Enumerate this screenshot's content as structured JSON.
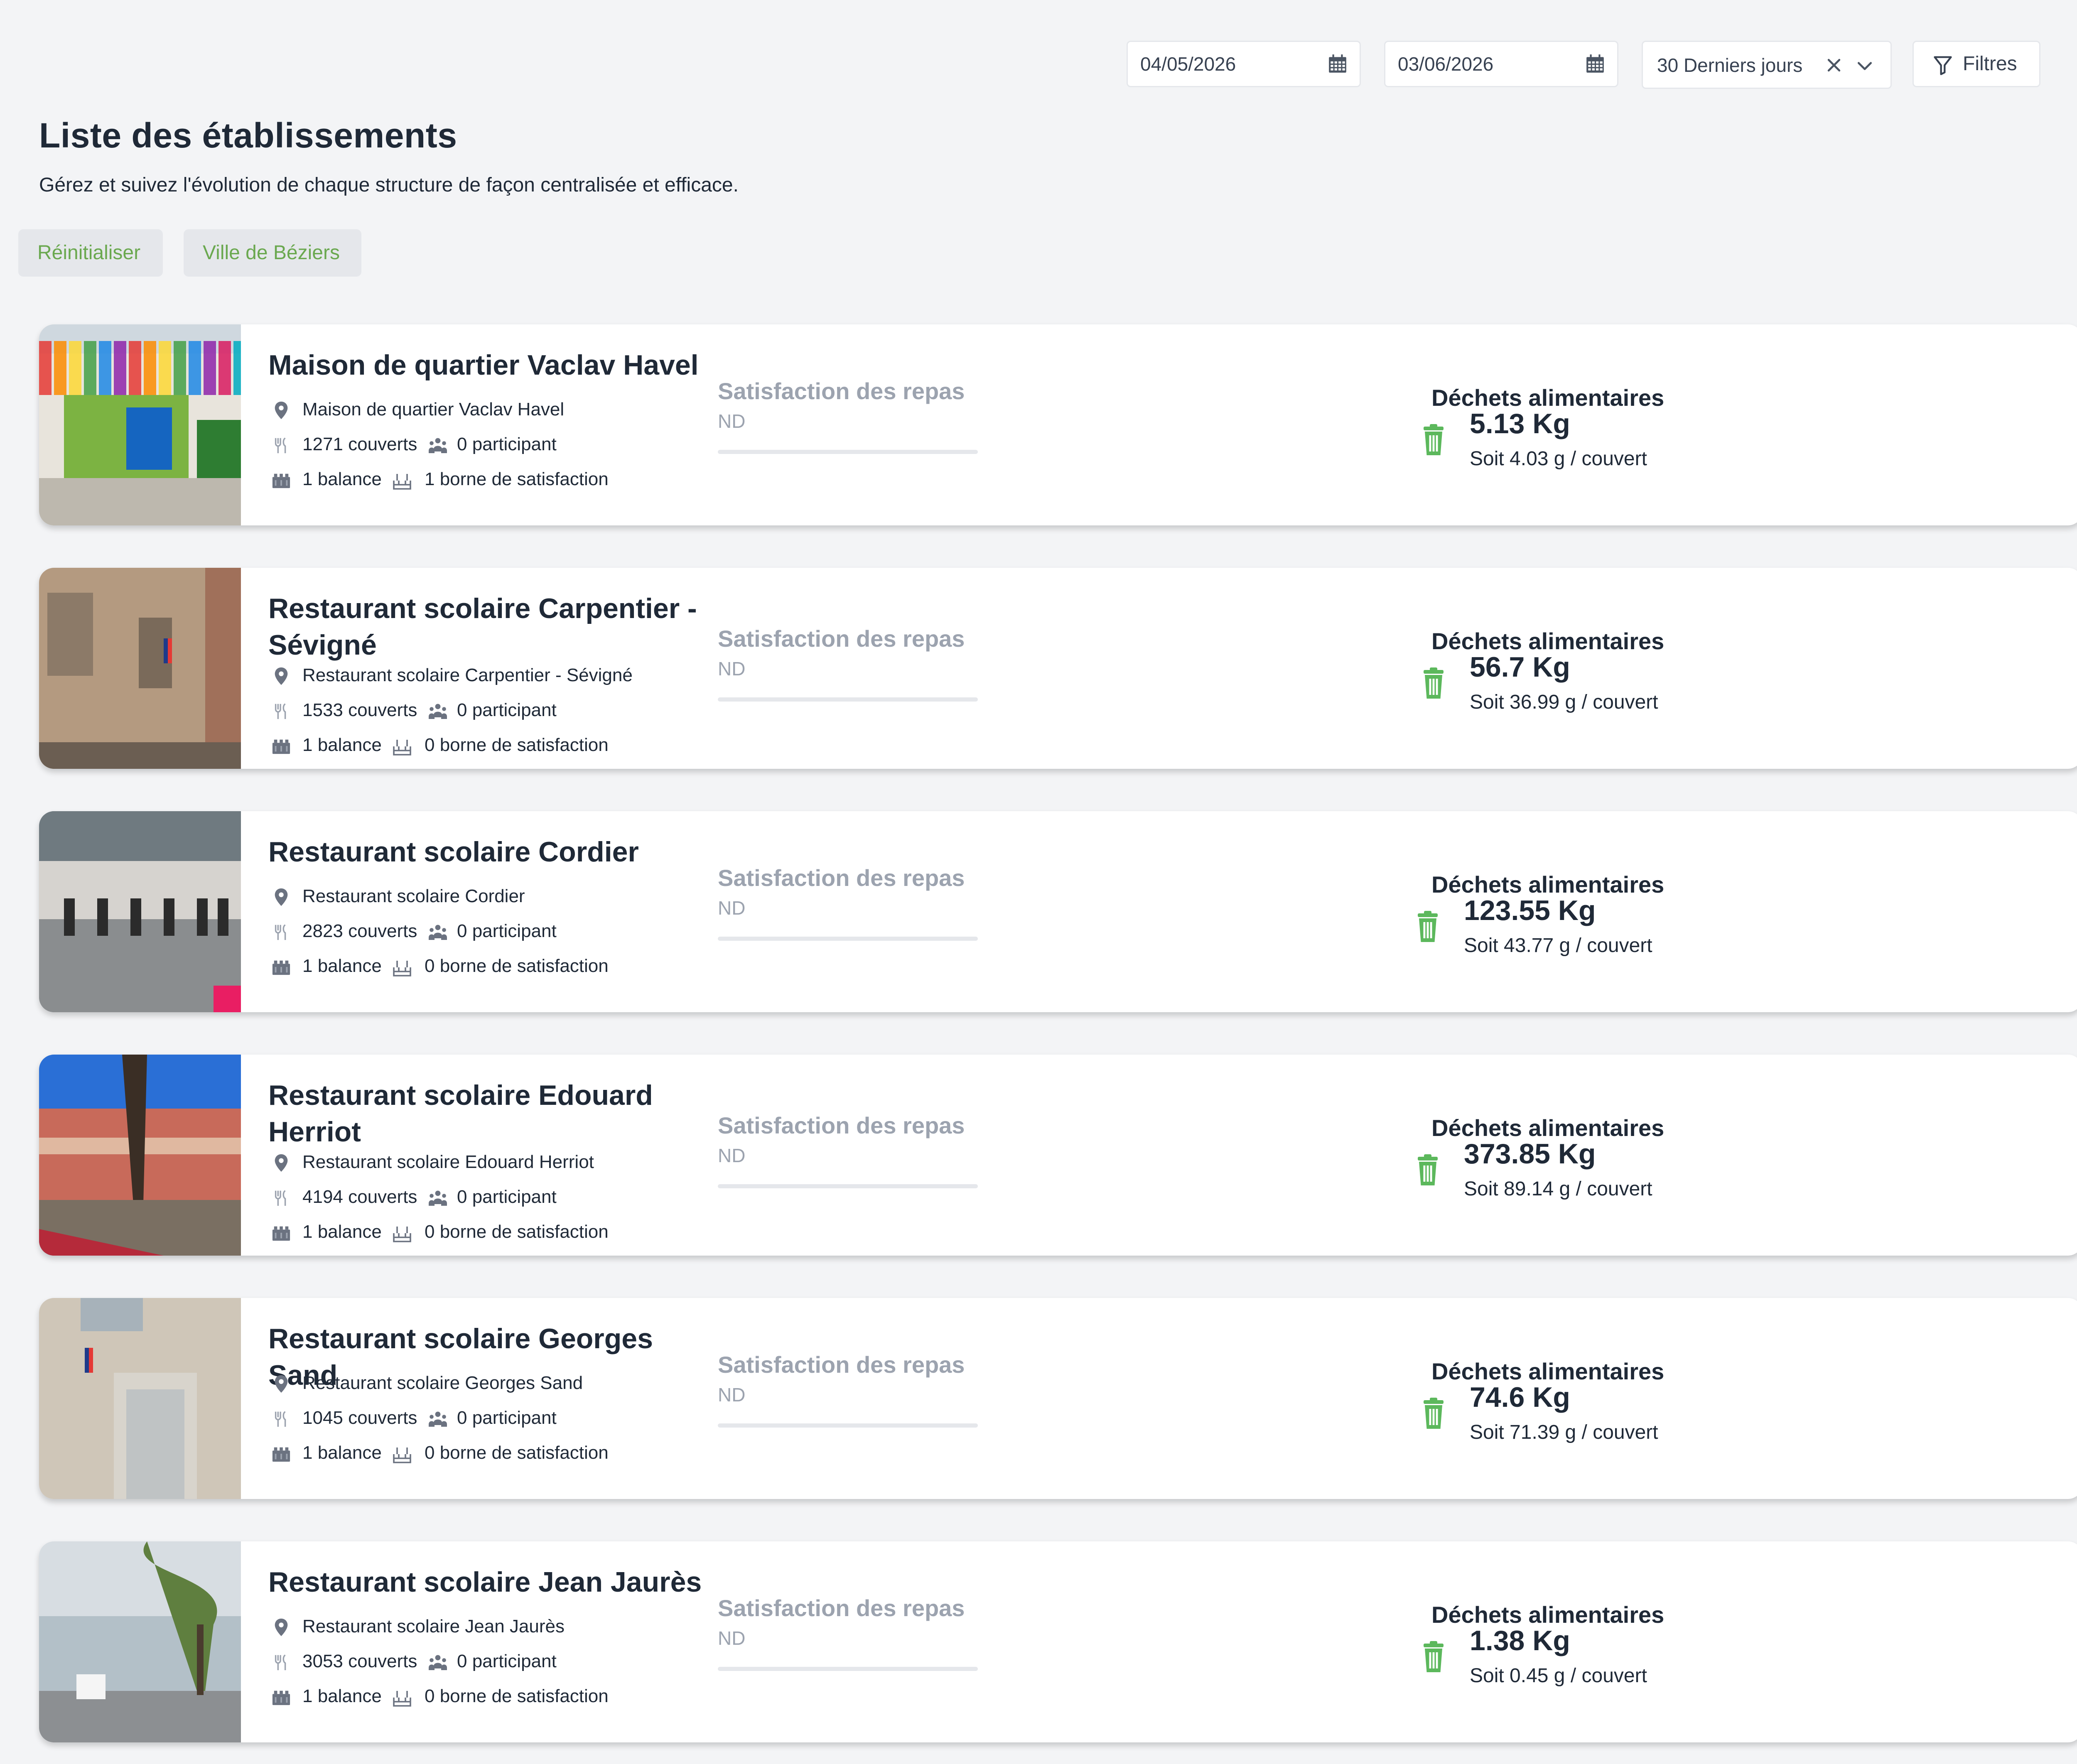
{
  "filters": {
    "start_date": "04/05/2026",
    "end_date": "03/06/2026",
    "range": "30 Derniers jours",
    "filters_label": "Filtres"
  },
  "header": {
    "title": "Liste des établissements",
    "subtitle": "Gérez et suivez l'évolution de chaque structure de façon centralisée et efficace."
  },
  "chips": {
    "reset": "Réinitialiser",
    "city": "Ville de Béziers"
  },
  "colors": {
    "accent_green": "#6aa84f",
    "waste_icon_green": "#5cb85c",
    "muted_text": "#9ca3af"
  },
  "card_labels": {
    "satisfaction": "Satisfaction des repas",
    "waste": "Déchets alimentaires"
  },
  "establishments": [
    {
      "name": "Maison de quartier Vaclav Havel",
      "address": "Maison de quartier Vaclav Havel",
      "covers": "1271 couverts",
      "participants": "0 participant",
      "scales": "1 balance",
      "terminals": "1 borne de satisfaction",
      "satisfaction": "ND",
      "waste_kg": "5.13 Kg",
      "waste_per_cover": "Soit 4.03 g / couvert"
    },
    {
      "name": "Restaurant scolaire Carpentier - Sévigné",
      "address": "Restaurant scolaire Carpentier - Sévigné",
      "covers": "1533 couverts",
      "participants": "0 participant",
      "scales": "1 balance",
      "terminals": "0 borne de satisfaction",
      "satisfaction": "ND",
      "waste_kg": "56.7 Kg",
      "waste_per_cover": "Soit 36.99 g / couvert"
    },
    {
      "name": "Restaurant scolaire Cordier",
      "address": "Restaurant scolaire Cordier",
      "covers": "2823 couverts",
      "participants": "0 participant",
      "scales": "1 balance",
      "terminals": "0 borne de satisfaction",
      "satisfaction": "ND",
      "waste_kg": "123.55 Kg",
      "waste_per_cover": "Soit 43.77 g / couvert"
    },
    {
      "name": "Restaurant scolaire Edouard Herriot",
      "address": "Restaurant scolaire Edouard Herriot",
      "covers": "4194 couverts",
      "participants": "0 participant",
      "scales": "1 balance",
      "terminals": "0 borne de satisfaction",
      "satisfaction": "ND",
      "waste_kg": "373.85 Kg",
      "waste_per_cover": "Soit 89.14 g / couvert"
    },
    {
      "name": "Restaurant scolaire Georges Sand",
      "address": "Restaurant scolaire Georges Sand",
      "covers": "1045 couverts",
      "participants": "0 participant",
      "scales": "1 balance",
      "terminals": "0 borne de satisfaction",
      "satisfaction": "ND",
      "waste_kg": "74.6 Kg",
      "waste_per_cover": "Soit 71.39 g / couvert"
    },
    {
      "name": "Restaurant scolaire Jean Jaurès",
      "address": "Restaurant scolaire Jean Jaurès",
      "covers": "3053 couverts",
      "participants": "0 participant",
      "scales": "1 balance",
      "terminals": "0 borne de satisfaction",
      "satisfaction": "ND",
      "waste_kg": "1.38 Kg",
      "waste_per_cover": "Soit 0.45 g / couvert"
    }
  ]
}
